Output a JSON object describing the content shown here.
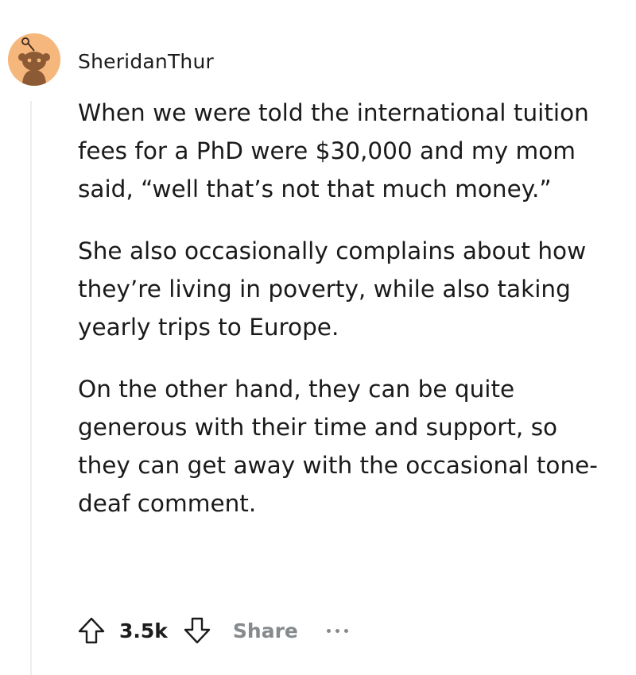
{
  "comment": {
    "username": "SheridanThur",
    "avatar_icon": "snoo-avatar-icon",
    "avatar_color": "#f6b77d",
    "paragraphs": [
      "When we were told the international tuition fees for a PhD were $30,000 and my mom said, “well that’s not that much money.”",
      "She also occasionally complains about how they’re living in poverty, while also taking yearly trips to Europe.",
      "On the other hand, they can be quite generous with their time and support, so they can get away with the occasional tone-deaf comment."
    ],
    "actions": {
      "upvote_icon": "upvote-arrow-icon",
      "score": "3.5k",
      "downvote_icon": "downvote-arrow-icon",
      "share_label": "Share",
      "more_icon": "more-options-icon"
    }
  }
}
